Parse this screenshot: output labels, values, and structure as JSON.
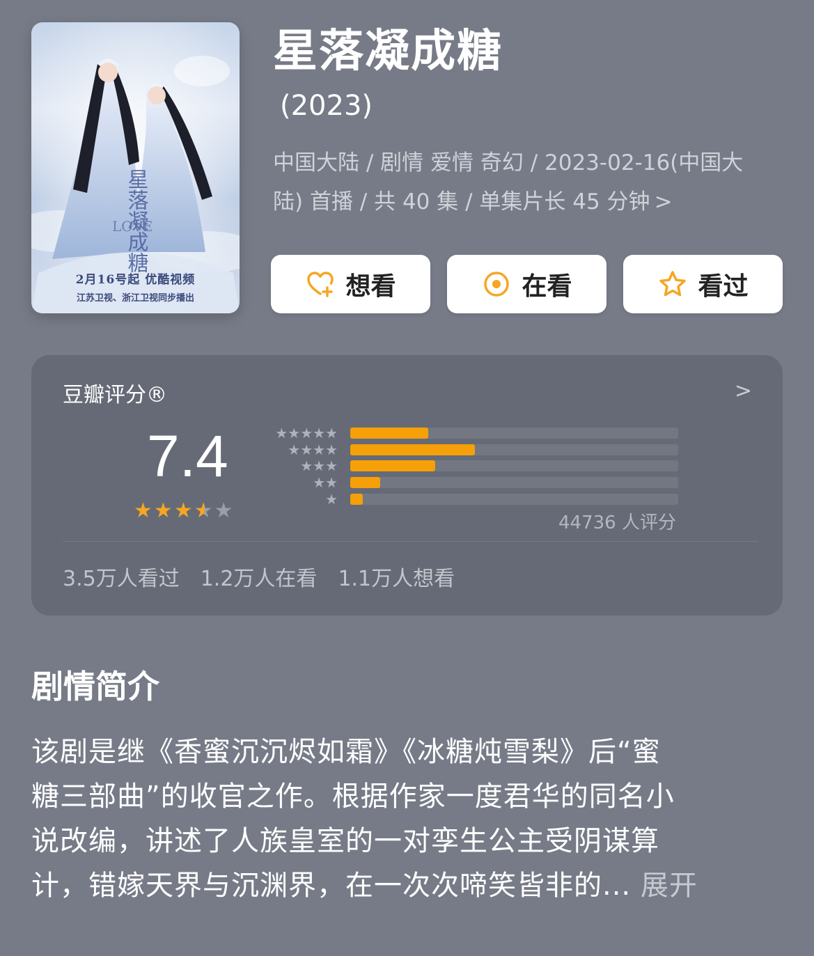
{
  "poster": {
    "date_line": "2月16号起  优酷视频",
    "channels_line": "江苏卫视、浙江卫视同步播出",
    "logo_text": "LOVE"
  },
  "title": "星落凝成糖",
  "year": "(2023)",
  "meta": {
    "line1": "中国大陆 / 剧情 爱情 奇幻 / 2023-02-16(中国大",
    "line2": "陆) 首播 / 共 40 集 / 单集片长 45 分钟",
    "chevron": ">"
  },
  "actions": {
    "want_label": "想看",
    "watching_label": "在看",
    "watched_label": "看过",
    "want_icon": "heart-plus-icon",
    "watching_icon": "target-icon",
    "watched_icon": "star-outline-icon",
    "icon_color": "#f5a623"
  },
  "rating": {
    "label": "豆瓣评分®",
    "arrow": ">",
    "score": "7.4",
    "stars_value": 3.5,
    "stars_max": 5,
    "distribution": [
      {
        "stars": "★★★★★",
        "fraction": 0.237
      },
      {
        "stars": "★★★★",
        "fraction": 0.379
      },
      {
        "stars": "★★★",
        "fraction": 0.259
      },
      {
        "stars": "★★",
        "fraction": 0.092
      },
      {
        "stars": "★",
        "fraction": 0.038
      }
    ],
    "total_votes": "44736 人评分",
    "counts": [
      "3.5万人看过",
      "1.2万人在看",
      "1.1万人想看"
    ],
    "bar_color": "#f5a008"
  },
  "synopsis": {
    "heading": "剧情简介",
    "lines": [
      "该剧是继《香蜜沉沉烬如霜》《冰糖炖雪梨》后“蜜",
      "糖三部曲”的收官之作。根据作家一度君华的同名小",
      "说改编，讲述了人族皇室的一对孪生公主受阴谋算",
      "计，错嫁天界与沉渊界，在一次次啼笑皆非的..."
    ],
    "more": " 展开"
  }
}
